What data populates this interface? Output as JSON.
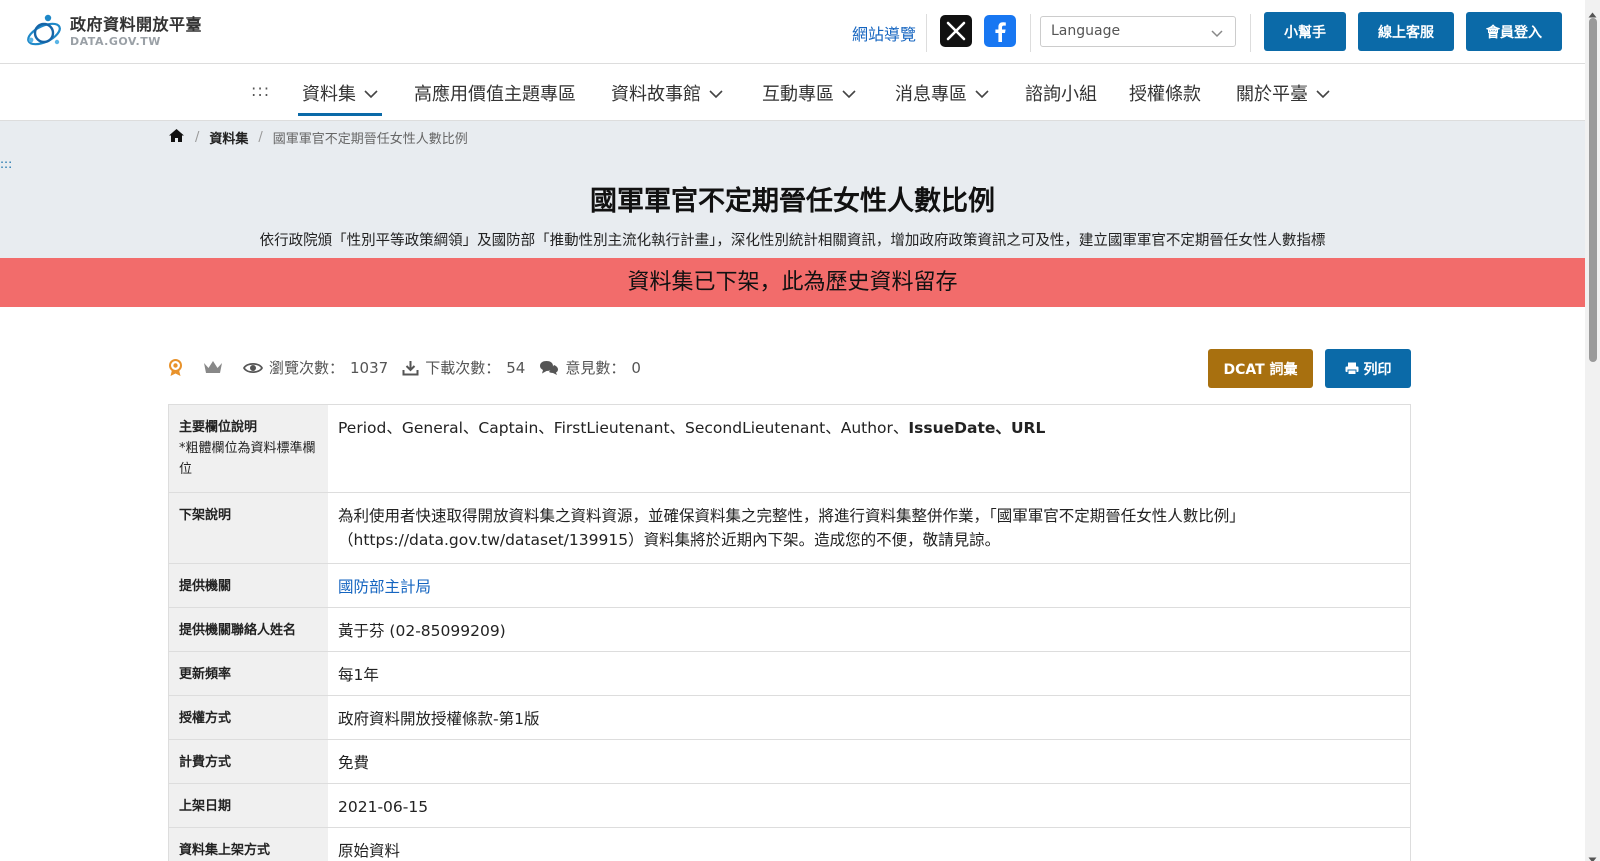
{
  "header": {
    "logo_title": "政府資料開放平臺",
    "logo_sub": "DATA.GOV.TW",
    "sitemap": "網站導覽",
    "language_placeholder": "Language",
    "buttons": {
      "helper": "小幫手",
      "service": "線上客服",
      "login": "會員登入"
    }
  },
  "nav": {
    "dots": ":::",
    "items": [
      {
        "label": "資料集",
        "dropdown": true,
        "active": true
      },
      {
        "label": "高應用價值主題專區",
        "dropdown": false
      },
      {
        "label": "資料故事館",
        "dropdown": true
      },
      {
        "label": "互動專區",
        "dropdown": true
      },
      {
        "label": "消息專區",
        "dropdown": true
      },
      {
        "label": "諮詢小組",
        "dropdown": false
      },
      {
        "label": "授權條款",
        "dropdown": false
      },
      {
        "label": "關於平臺",
        "dropdown": true
      }
    ]
  },
  "breadcrumb": {
    "level1": "資料集",
    "current": "國軍軍官不定期晉任女性人數比例"
  },
  "skip_dots": ":::",
  "dataset": {
    "title": "國軍軍官不定期晉任女性人數比例",
    "description": "依行政院頒「性別平等政策綱領」及國防部「推動性別主流化執行計畫」，深化性別統計相關資訊，增加政府政策資訊之可及性，建立國軍軍官不定期晉任女性人數指標",
    "banner": "資料集已下架，此為歷史資料留存"
  },
  "stats": {
    "views_label": "瀏覽次數：",
    "views": "1037",
    "downloads_label": "下載次數：",
    "downloads": "54",
    "comments_label": "意見數：",
    "comments": "0"
  },
  "actions": {
    "dcat": "DCAT 詞彙",
    "print": "列印"
  },
  "table": {
    "fields_label": "主要欄位說明",
    "fields_note": "*粗體欄位為資料標準欄位",
    "fields_plain": "Period、General、Captain、FirstLieutenant、SecondLieutenant、Author、",
    "fields_bold_1": "IssueDate",
    "fields_sep": "、",
    "fields_bold_2": "URL",
    "rows": [
      {
        "label": "下架說明",
        "value": "為利使用者快速取得開放資料集之資料資源，並確保資料集之完整性，將進行資料集整併作業，「國軍軍官不定期晉任女性人數比例」（https://data.gov.tw/dataset/139915）資料集將於近期內下架。造成您的不便，敬請見諒。"
      },
      {
        "label": "提供機關",
        "value": "國防部主計局"
      },
      {
        "label": "提供機關聯絡人姓名",
        "value": "黃于芬 (02-85099209)"
      },
      {
        "label": "更新頻率",
        "value": "每1年"
      },
      {
        "label": "授權方式",
        "value": "政府資料開放授權條款-第1版"
      },
      {
        "label": "計費方式",
        "value": "免費"
      },
      {
        "label": "上架日期",
        "value": "2021-06-15"
      },
      {
        "label": "資料集上架方式",
        "value": "原始資料"
      }
    ]
  },
  "colors": {
    "primary": "#0b6aa8",
    "dcat": "#a8700f",
    "banner": "#f26c6b",
    "hero_bg": "#e8ecf0",
    "link": "#1565c0"
  }
}
